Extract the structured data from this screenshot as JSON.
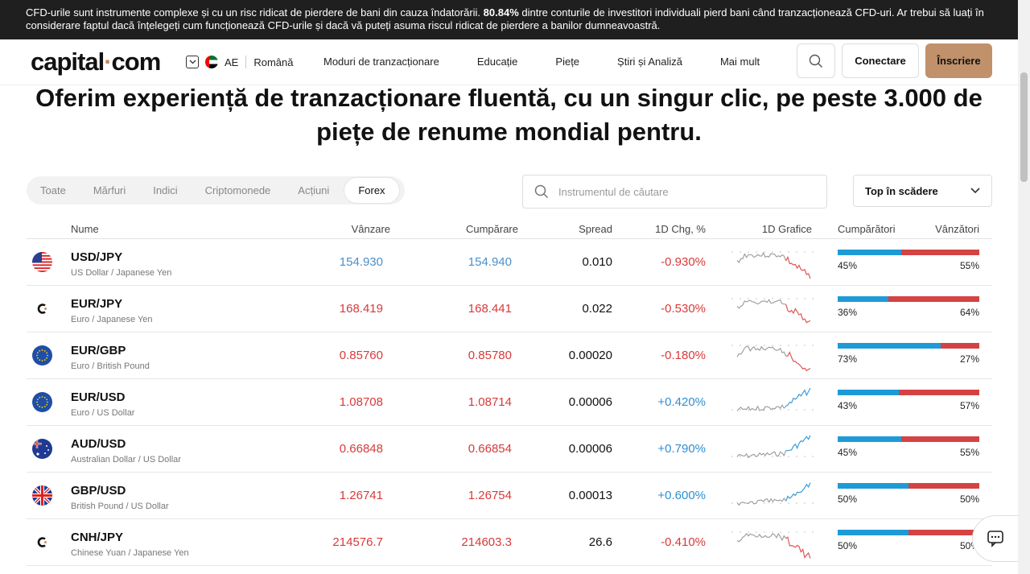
{
  "risk_banner": {
    "text_before": "CFD-urile sunt instrumente complexe și cu un risc ridicat de pierdere de bani din cauza îndatorării. ",
    "percentage": "80.84%",
    "text_after": " dintre conturile de investitori individuali pierd bani când tranzacționează CFD-uri. Ar trebui să luați în considerare faptul dacă înțelegeți cum funcționează CFD-urile și dacă vă puteți asuma riscul ridicat de pierdere a banilor dumneavoastră."
  },
  "header": {
    "logo_left": "capital",
    "logo_dot": "·",
    "logo_right": "com",
    "region_code": "AE",
    "language": "Română",
    "nav": [
      "Moduri de tranzacționare",
      "Educație",
      "Piețe",
      "Știri și Analiză",
      "Mai mult"
    ],
    "login_label": "Conectare",
    "signup_label": "Înscriere"
  },
  "heading": "Oferim experiență de tranzacționare fluentă, cu un singur clic, pe peste 3.000 de piețe de renume mondial pentru.",
  "filters": {
    "tabs": [
      "Toate",
      "Mărfuri",
      "Indici",
      "Criptomonede",
      "Acțiuni",
      "Forex"
    ],
    "active_tab": "Forex",
    "search_placeholder": "Instrumentul de căutare",
    "sort_label": "Top în scădere"
  },
  "table": {
    "headers": {
      "name": "Nume",
      "sell": "Vânzare",
      "buy": "Cumpărare",
      "spread": "Spread",
      "change": "1D Chg, %",
      "chart": "1D Grafice",
      "buyers": "Cumpărători",
      "sellers": "Vânzători"
    },
    "rows": [
      {
        "symbol": "USD/JPY",
        "desc": "US Dollar / Japanese Yen",
        "sell": "154.930",
        "buy": "154.940",
        "spread": "0.010",
        "change": "-0.930%",
        "buyers": "45%",
        "sellers": "55%",
        "buyers_share": 45,
        "trend": "down",
        "flag": "us",
        "price_color": "blue"
      },
      {
        "symbol": "EUR/JPY",
        "desc": "Euro / Japanese Yen",
        "sell": "168.419",
        "buy": "168.441",
        "spread": "0.022",
        "change": "-0.530%",
        "buyers": "36%",
        "sellers": "64%",
        "buyers_share": 36,
        "trend": "down",
        "flag": "capital",
        "price_color": "red"
      },
      {
        "symbol": "EUR/GBP",
        "desc": "Euro / British Pound",
        "sell": "0.85760",
        "buy": "0.85780",
        "spread": "0.00020",
        "change": "-0.180%",
        "buyers": "73%",
        "sellers": "27%",
        "buyers_share": 73,
        "trend": "down",
        "flag": "eu",
        "price_color": "red"
      },
      {
        "symbol": "EUR/USD",
        "desc": "Euro / US Dollar",
        "sell": "1.08708",
        "buy": "1.08714",
        "spread": "0.00006",
        "change": "+0.420%",
        "buyers": "43%",
        "sellers": "57%",
        "buyers_share": 43,
        "trend": "up",
        "flag": "eu",
        "price_color": "red"
      },
      {
        "symbol": "AUD/USD",
        "desc": "Australian Dollar / US Dollar",
        "sell": "0.66848",
        "buy": "0.66854",
        "spread": "0.00006",
        "change": "+0.790%",
        "buyers": "45%",
        "sellers": "55%",
        "buyers_share": 45,
        "trend": "up",
        "flag": "au",
        "price_color": "red"
      },
      {
        "symbol": "GBP/USD",
        "desc": "British Pound / US Dollar",
        "sell": "1.26741",
        "buy": "1.26754",
        "spread": "0.00013",
        "change": "+0.600%",
        "buyers": "50%",
        "sellers": "50%",
        "buyers_share": 50,
        "trend": "up",
        "flag": "gb",
        "price_color": "red"
      },
      {
        "symbol": "CNH/JPY",
        "desc": "Chinese Yuan / Japanese Yen",
        "sell": "214576.7",
        "buy": "214603.3",
        "spread": "26.6",
        "change": "-0.410%",
        "buyers": "50%",
        "sellers": "50%",
        "buyers_share": 50,
        "trend": "down",
        "flag": "capital",
        "price_color": "red"
      }
    ]
  },
  "colors": {
    "accent": "#c0916a",
    "positive": "#2e8fd0",
    "negative": "#d73a3a",
    "buyers_bar": "#1e9bd7",
    "sellers_bar": "#d44343"
  },
  "icons": [
    "search-icon",
    "chevron-down-icon",
    "chat-icon"
  ]
}
